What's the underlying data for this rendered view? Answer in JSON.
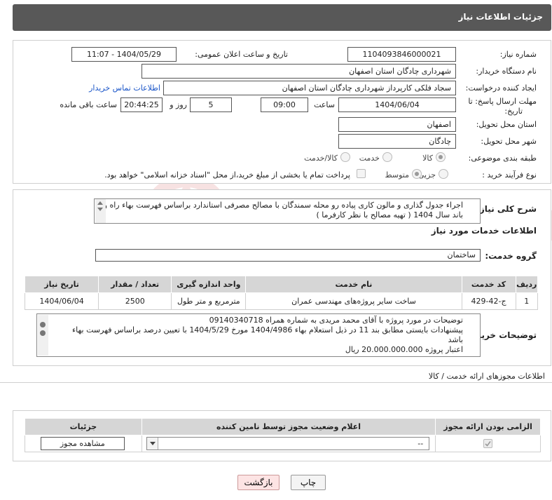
{
  "header": {
    "title": "جزئیات اطلاعات نیاز"
  },
  "form": {
    "need_number_label": "شماره نیاز:",
    "need_number": "1104093846000021",
    "announce_label": "تاریخ و ساعت اعلان عمومی:",
    "announce_value": "1404/05/29 - 11:07",
    "buyer_org_label": "نام دستگاه خریدار:",
    "buyer_org": "شهرداری چادگان استان اصفهان",
    "creator_label": "ایجاد کننده درخواست:",
    "creator": "سجاد فلکی کارپرداز شهرداری چادگان استان اصفهان",
    "contact_link": "اطلاعات تماس خریدار",
    "deadline_label_1": "مهلت ارسال پاسخ: تا",
    "deadline_label_2": "تاریخ:",
    "deadline_date": "1404/06/04",
    "time_label": "ساعت",
    "deadline_time": "09:00",
    "days_value": "5",
    "days_label": "روز و",
    "remaining_time": "20:44:25",
    "remaining_label": "ساعت باقی مانده",
    "province_label": "استان محل تحویل:",
    "province": "اصفهان",
    "city_label": "شهر محل تحویل:",
    "city": "چادگان",
    "category_label": "طبقه بندی موضوعی:",
    "category_options": [
      "کالا",
      "خدمت",
      "کالا/خدمت"
    ],
    "process_label": "نوع فرآیند خرید :",
    "process_options": [
      "جزیی",
      "متوسط"
    ],
    "treasury_note": "پرداخت تمام یا بخشی از مبلغ خرید،از محل \"اسناد خزانه اسلامی\" خواهد بود."
  },
  "details": {
    "summary_label": "شرح کلی نیاز:",
    "summary_text": "اجراء جدول گذاری و مالون کاری پیاده رو محله سمندگان با مصالح مصرفی استاندارد براساس فهرست بهاء راه و باند سال 1404 ( تهیه مصالح با نظر کارفرما )",
    "services_title": "اطلاعات خدمات مورد نیاز",
    "service_group_label": "گروه خدمت:",
    "service_group": "ساختمان",
    "table_headers": [
      "ردیف",
      "کد خدمت",
      "نام خدمت",
      "واحد اندازه گیری",
      "تعداد / مقدار",
      "تاریخ نیاز"
    ],
    "table_rows": [
      [
        "1",
        "ج-42-429",
        "ساخت سایر پروژه‌های مهندسی عمران",
        "مترمربع و متر طول",
        "2500",
        "1404/06/04"
      ]
    ],
    "buyer_notes_label": "توضیحات خریدار:",
    "buyer_notes_lines": [
      "توضیحات در مورد پروژه با آقای محمد مریدی به شماره همراه 09140340718",
      "پیشنهادات بایستی مطابق بند 11 در ذیل استعلام بهاء 1404/4986 مورخ 1404/5/29 با تعیین درصد براساس فهرست بهاء",
      "باشد",
      "اعتبار پروژه 20.000.000.000 ریال"
    ]
  },
  "permits": {
    "section_title": "اطلاعات مجوزهای ارائه خدمت / کالا",
    "headers": [
      "الزامی بودن ارائه مجوز",
      "اعلام وضعیت مجوز توسط نامین کننده",
      "جزئیات"
    ],
    "select_value": "--",
    "view_button": "مشاهده مجوز"
  },
  "actions": {
    "print": "چاپ",
    "back": "بازگشت"
  },
  "watermark": {
    "text": "AriaTender.net"
  }
}
